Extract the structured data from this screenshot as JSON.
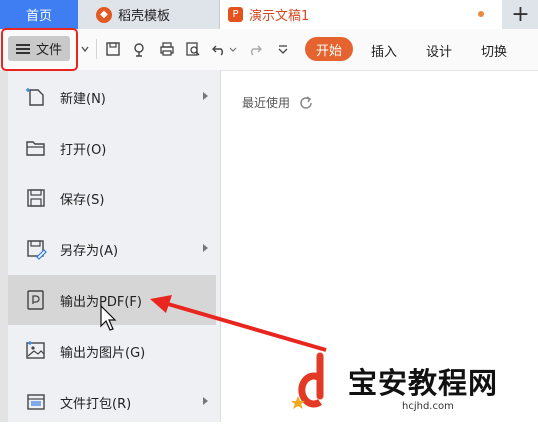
{
  "tabs": {
    "home": "首页",
    "template": "稻壳模板",
    "document": "演示文稿1",
    "add": "+"
  },
  "toolbar": {
    "file_menu": "文件",
    "start": "开始",
    "insert": "插入",
    "design": "设计",
    "switch": "切换"
  },
  "menu": {
    "items": [
      {
        "label": "新建(N)",
        "icon": "new-file-icon",
        "submenu": true
      },
      {
        "label": "打开(O)",
        "icon": "folder-icon",
        "submenu": false
      },
      {
        "label": "保存(S)",
        "icon": "save-icon",
        "submenu": false
      },
      {
        "label": "另存为(A)",
        "icon": "save-as-icon",
        "submenu": true
      },
      {
        "label": "输出为PDF(F)",
        "icon": "pdf-icon",
        "submenu": false,
        "highlighted": true
      },
      {
        "label": "输出为图片(G)",
        "icon": "image-icon",
        "submenu": false
      },
      {
        "label": "文件打包(R)",
        "icon": "package-icon",
        "submenu": true
      }
    ]
  },
  "recent": {
    "label": "最近使用"
  },
  "watermark": {
    "title": "宝安教程网",
    "url": "hcjhd.com"
  },
  "colors": {
    "accent": "#e5632f",
    "home_tab": "#3f7ef2",
    "annotation": "#e8261f"
  }
}
